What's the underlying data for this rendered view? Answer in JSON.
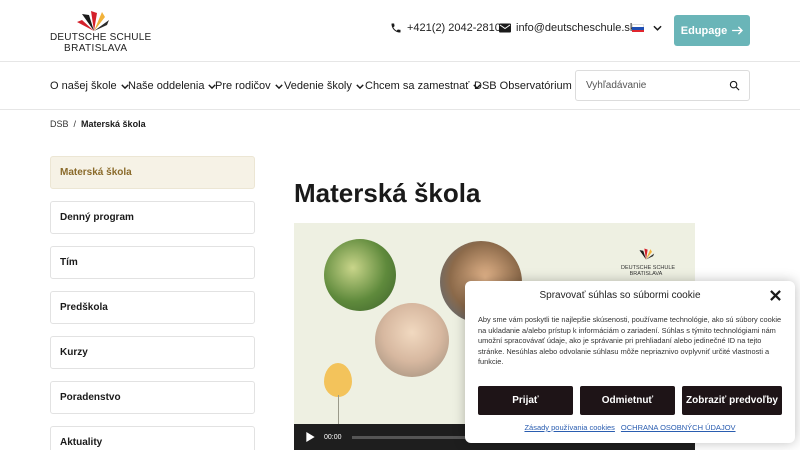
{
  "header": {
    "logo_line1": "DEUTSCHE SCHULE",
    "logo_line2": "BRATISLAVA",
    "phone": "+421(2) 2042-2810",
    "email": "info@deutscheschule.sk",
    "language_flag": "slovak-flag",
    "edupage_label": "Edupage",
    "colors": {
      "edupage": "#6ab5b8"
    }
  },
  "nav": {
    "items": [
      {
        "label": "O našej škole",
        "has_dropdown": true
      },
      {
        "label": "Naše oddelenia",
        "has_dropdown": true
      },
      {
        "label": "Pre rodičov",
        "has_dropdown": true
      },
      {
        "label": "Vedenie školy",
        "has_dropdown": true
      },
      {
        "label": "Chcem sa zamestnať",
        "has_dropdown": true
      },
      {
        "label": "DSB Observatórium",
        "has_dropdown": false
      }
    ],
    "search_placeholder": "Vyhľadávanie"
  },
  "breadcrumb": {
    "root": "DSB",
    "separator": "/",
    "current": "Materská škola"
  },
  "sidebar": {
    "items": [
      {
        "label": "Materská škola",
        "active": true
      },
      {
        "label": "Denný program",
        "active": false
      },
      {
        "label": "Tím",
        "active": false
      },
      {
        "label": "Predškola",
        "active": false
      },
      {
        "label": "Kurzy",
        "active": false
      },
      {
        "label": "Poradenstvo",
        "active": false
      },
      {
        "label": "Aktuality",
        "active": false
      }
    ]
  },
  "main": {
    "title": "Materská škola",
    "video": {
      "time": "00:00",
      "logo_line1": "DEUTSCHE SCHULE",
      "logo_line2": "BRATISLAVA"
    }
  },
  "cookie": {
    "title": "Spravovať súhlas so súbormi cookie",
    "text": "Aby sme vám poskytli tie najlepšie skúsenosti, používame technológie, ako sú súbory cookie na ukladanie a/alebo prístup k informáciám o zariadení. Súhlas s týmito technológiami nám umožní spracovávať údaje, ako je správanie pri prehliadaní alebo jedinečné ID na tejto stránke. Nesúhlas alebo odvolanie súhlasu môže nepriaznivo ovplyvniť určité vlastnosti a funkcie.",
    "accept": "Prijať",
    "reject": "Odmietnuť",
    "preferences": "Zobraziť predvoľby",
    "link_policy": "Zásady používania cookies",
    "link_privacy": "OCHRANA OSOBNÝCH ÚDAJOV"
  }
}
